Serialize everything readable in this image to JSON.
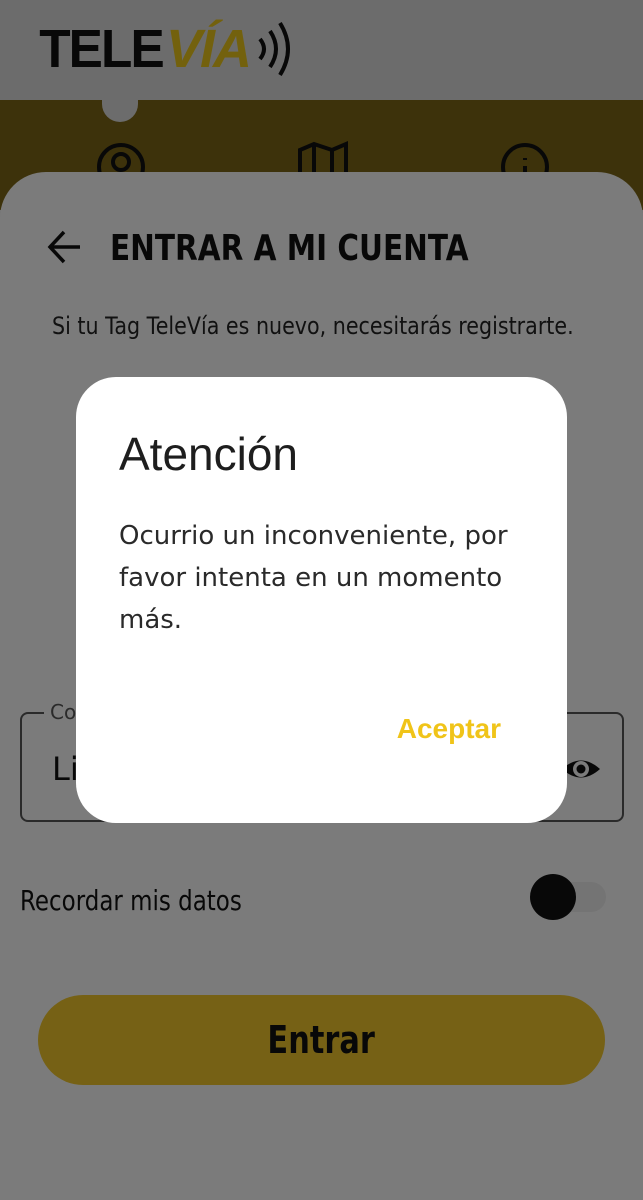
{
  "app": {
    "logo": {
      "part1": "TELE",
      "part2": "VÍA"
    },
    "nav": {
      "icons": [
        "account-icon",
        "map-icon",
        "info-icon"
      ]
    },
    "login": {
      "title": "ENTRAR A MI CUENTA",
      "subtitle": "Si tu Tag TeleVía es nuevo, necesitarás registrarte.",
      "password_label": "Contraseña",
      "password_value": "Li",
      "remember_label": "Recordar mis datos",
      "remember_enabled": false,
      "submit_label": "Entrar"
    }
  },
  "dialog": {
    "title": "Atención",
    "message": "Ocurrio un inconveniente, por favor intenta en un momento más.",
    "accept_label": "Aceptar"
  },
  "colors": {
    "brand_yellow": "#ecc32b",
    "accent_button_text": "#f0c419",
    "scrim": "rgba(0,0,0,0.5)"
  }
}
